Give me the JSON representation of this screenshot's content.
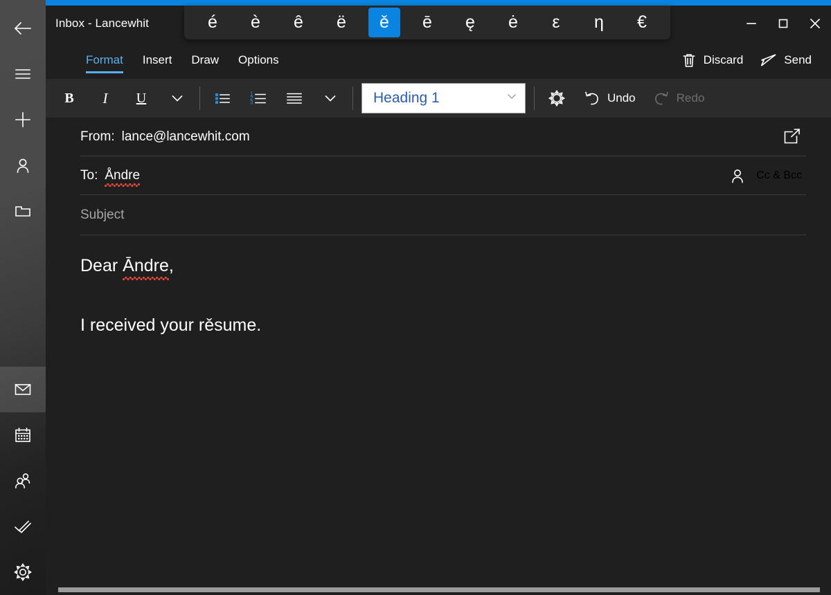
{
  "theme": {
    "accent_blue": "#0a84e0",
    "tab_active_blue": "#59b0f0",
    "list_icon_blue": "#2a8ad4",
    "window_bg": "#1f1f1f",
    "toolbar_bg": "#2b2b2b",
    "rail_bg": "#3b3b3b",
    "style_text_blue": "#2a5db0",
    "spellcheck_red": "#e8483c"
  },
  "titlebar": {
    "title": "Inbox - Lancewhit",
    "back_icon": "back-arrow-icon",
    "minimize_label": "Minimize",
    "maximize_label": "Maximize",
    "close_label": "Close"
  },
  "accent_popup": {
    "keys": [
      {
        "char": "é",
        "name": "e-acute",
        "selected": false
      },
      {
        "char": "è",
        "name": "e-grave",
        "selected": false
      },
      {
        "char": "ê",
        "name": "e-circumflex",
        "selected": false
      },
      {
        "char": "ë",
        "name": "e-diaeresis",
        "selected": false
      },
      {
        "char": "ě",
        "name": "e-caron",
        "selected": true
      },
      {
        "char": "ē",
        "name": "e-macron",
        "selected": false
      },
      {
        "char": "ę",
        "name": "e-ogonek",
        "selected": false
      },
      {
        "char": "ė",
        "name": "e-dot-above",
        "selected": false
      },
      {
        "char": "ε",
        "name": "greek-epsilon",
        "selected": false
      },
      {
        "char": "η",
        "name": "greek-eta",
        "selected": false
      },
      {
        "char": "€",
        "name": "euro-sign",
        "selected": false
      }
    ]
  },
  "sidebar": {
    "top_items": [
      {
        "label": "Menu",
        "icon": "hamburger-menu-icon"
      },
      {
        "label": "New mail",
        "icon": "plus-icon"
      },
      {
        "label": "People",
        "icon": "person-icon"
      },
      {
        "label": "Folders",
        "icon": "folder-icon"
      }
    ],
    "bottom_items": [
      {
        "label": "Mail",
        "icon": "mail-icon",
        "active": true
      },
      {
        "label": "Calendar",
        "icon": "calendar-icon",
        "active": false
      },
      {
        "label": "People",
        "icon": "people-icon",
        "active": false
      },
      {
        "label": "To Do",
        "icon": "tasks-check-icon",
        "active": false
      },
      {
        "label": "Settings",
        "icon": "gear-icon",
        "active": false
      }
    ]
  },
  "ribbon": {
    "tabs": [
      {
        "label": "Format",
        "active": true
      },
      {
        "label": "Insert",
        "active": false
      },
      {
        "label": "Draw",
        "active": false
      },
      {
        "label": "Options",
        "active": false
      }
    ],
    "actions": [
      {
        "label": "Discard",
        "icon": "trash-icon"
      },
      {
        "label": "Send",
        "icon": "send-paperplane-icon"
      }
    ]
  },
  "toolbar": {
    "bold_label": "B",
    "italic_label": "I",
    "underline_label": "U",
    "font_more_label": "⌄",
    "bullet_list_label": "Bullets",
    "numbered_list_label": "Numbering",
    "align_label": "Align",
    "paragraph_more_label": "⌄",
    "style_value": "Heading 1",
    "style_chevron": "⌄",
    "highlight_label": "Styles",
    "undo_label": "Undo",
    "redo_label": "Redo",
    "redo_disabled": true,
    "numbered_digits": [
      "1",
      "2",
      "3"
    ]
  },
  "compose": {
    "from_label": "From:",
    "from_value": "lance@lancewhit.com",
    "popout_label": "Open in new window",
    "to_label": "To:",
    "to_value": "Åndre",
    "to_misspelled": true,
    "contacts_icon": "person-icon",
    "cc_bcc_label": "Cc & Bcc",
    "subject_placeholder": "Subject",
    "subject_value": ""
  },
  "body": {
    "lines": [
      {
        "prefix": "Dear ",
        "misspelled": "Āndre",
        "suffix": ","
      },
      {
        "prefix": "I received your rěsume.",
        "misspelled": "",
        "suffix": ""
      }
    ],
    "greeting_full": "Dear Āndre,",
    "sentence_full": "I received your rěsume."
  }
}
